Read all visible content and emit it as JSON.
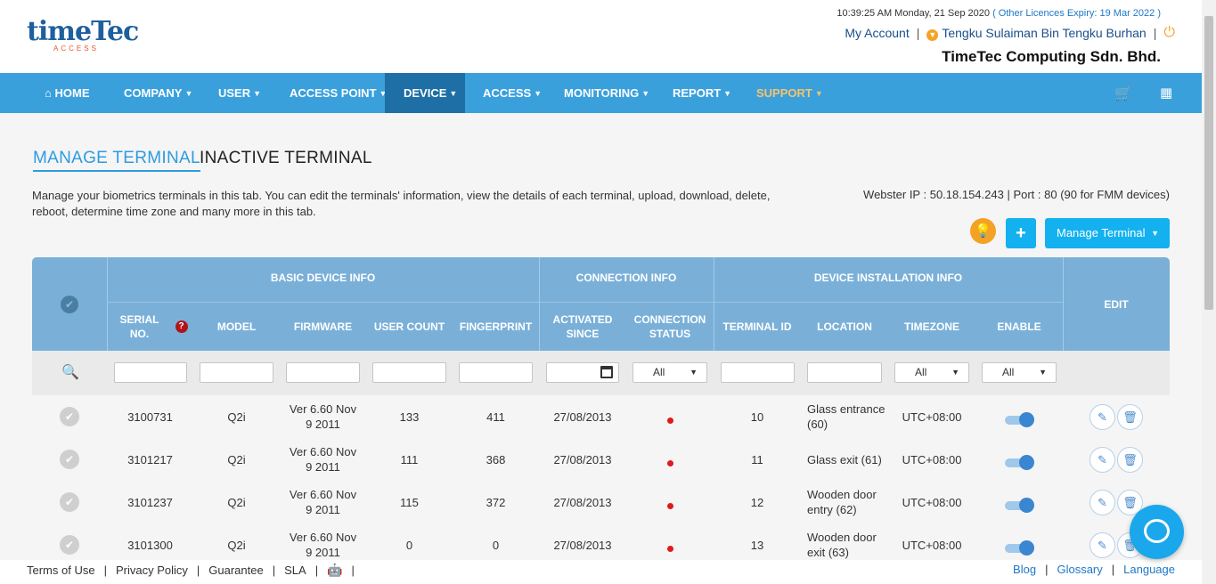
{
  "header": {
    "logo_main": "timeTec",
    "logo_sub": "ACCESS",
    "datetime": "10:39:25 AM Monday, 21 Sep 2020",
    "licence": "( Other Licences Expiry:  19 Mar 2022 )",
    "my_account": "My Account",
    "user_name": "Tengku Sulaiman Bin Tengku Burhan",
    "separator": "|",
    "company_name": "TimeTec Computing Sdn. Bhd."
  },
  "nav": {
    "items": [
      {
        "label": "HOME"
      },
      {
        "label": "COMPANY"
      },
      {
        "label": "USER"
      },
      {
        "label": "ACCESS POINT"
      },
      {
        "label": "DEVICE"
      },
      {
        "label": "ACCESS"
      },
      {
        "label": "MONITORING"
      },
      {
        "label": "REPORT"
      },
      {
        "label": "SUPPORT"
      }
    ],
    "icons": [
      "home-icon",
      "cart-icon",
      "apps-grid-icon"
    ]
  },
  "tabs": {
    "manage": "MANAGE TERMINAL",
    "inactive": "INACTIVE TERMINAL"
  },
  "description": "Manage your biometrics terminals in this tab. You can edit the terminals' information, view the details of each terminal, upload, download, delete, reboot, determine time zone and many more in this tab.",
  "webster": "Webster IP : 50.18.154.243 | Port : 80 (90 for FMM devices)",
  "actions": {
    "plus": "+",
    "manage_terminal": "Manage Terminal"
  },
  "table": {
    "groups": {
      "basic": "BASIC DEVICE INFO",
      "connection": "CONNECTION INFO",
      "installation": "DEVICE INSTALLATION INFO",
      "edit": "EDIT"
    },
    "columns": {
      "serial": "SERIAL NO.",
      "model": "MODEL",
      "firmware": "FIRMWARE",
      "user_count": "USER COUNT",
      "fingerprint": "FINGERPRINT",
      "activated": "ACTIVATED SINCE",
      "status": "CONNECTION STATUS",
      "terminal_id": "TERMINAL ID",
      "location": "LOCATION",
      "timezone": "TIMEZONE",
      "enable": "ENABLE"
    },
    "filters": {
      "status_value": "All",
      "timezone_value": "All",
      "enable_value": "All"
    },
    "rows": [
      {
        "serial": "3100731",
        "model": "Q2i",
        "firmware": "Ver 6.60 Nov 9 2011",
        "user_count": "133",
        "fingerprint": "411",
        "activated": "27/08/2013",
        "terminal_id": "10",
        "location": "Glass entrance (60)",
        "timezone": "UTC+08:00"
      },
      {
        "serial": "3101217",
        "model": "Q2i",
        "firmware": "Ver 6.60 Nov 9 2011",
        "user_count": "111",
        "fingerprint": "368",
        "activated": "27/08/2013",
        "terminal_id": "11",
        "location": "Glass exit (61)",
        "timezone": "UTC+08:00"
      },
      {
        "serial": "3101237",
        "model": "Q2i",
        "firmware": "Ver 6.60 Nov 9 2011",
        "user_count": "115",
        "fingerprint": "372",
        "activated": "27/08/2013",
        "terminal_id": "12",
        "location": "Wooden door entry (62)",
        "timezone": "UTC+08:00"
      },
      {
        "serial": "3101300",
        "model": "Q2i",
        "firmware": "Ver 6.60 Nov 9 2011",
        "user_count": "0",
        "fingerprint": "0",
        "activated": "27/08/2013",
        "terminal_id": "13",
        "location": "Wooden door exit (63)",
        "timezone": "UTC+08:00"
      }
    ]
  },
  "footer": {
    "terms": "Terms of Use",
    "privacy": "Privacy Policy",
    "guarantee": "Guarantee",
    "sla": "SLA",
    "blog": "Blog",
    "glossary": "Glossary",
    "language": "Language",
    "sep": "|"
  },
  "colors": {
    "nav_bg": "#3aa0dc",
    "nav_active": "#1d6fa5",
    "accent": "#13b1ef",
    "table_header": "#7ab0d8",
    "status_offline": "#e0191c"
  }
}
